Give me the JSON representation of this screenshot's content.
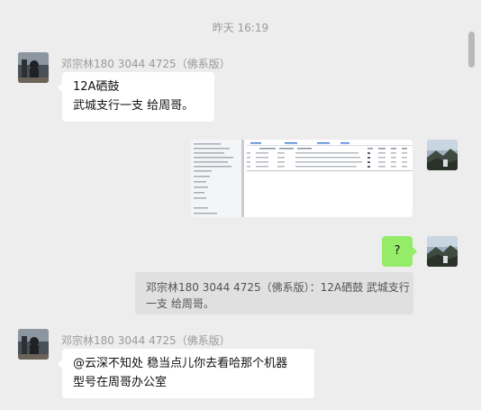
{
  "timestamp": "昨天 16:19",
  "messages": [
    {
      "sender": "邓宗林180 3044 4725（佛系版）",
      "lines": [
        "12A硒鼓",
        "武城支行一支 给周哥。"
      ]
    },
    {
      "type": "image",
      "description_icon": "screenshot-thumbnail"
    },
    {
      "text": "?"
    },
    {
      "quote_lines": [
        "邓宗林180 3044 4725（佛系版）：12A硒鼓 武城支行",
        "一支 给周哥。"
      ]
    },
    {
      "sender": "邓宗林180 3044 4725（佛系版）",
      "lines": [
        "@云深不知处 稳当点儿你去看哈那个机器",
        "型号在周哥办公室"
      ]
    }
  ],
  "colors": {
    "background": "#ededed",
    "own_bubble": "#95ec69",
    "other_bubble": "#ffffff"
  }
}
